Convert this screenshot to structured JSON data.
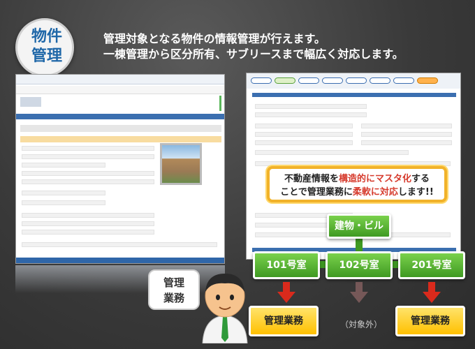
{
  "badge": {
    "line1": "物件",
    "line2": "管理"
  },
  "headline": {
    "line1": "管理対象となる物件の情報管理が行えます。",
    "line2": "一棟管理から区分所有、サブリースまで幅広く対応します。"
  },
  "callout": {
    "line1_pre": "不動産情報を",
    "line1_hl": "構造的にマスタ化",
    "line1_post": "する",
    "line2_pre": "ことで管理業務に",
    "line2_hl": "柔軟に対応",
    "line2_post": "します!!"
  },
  "diagram": {
    "building": "建物・ビル",
    "units": [
      "101号室",
      "102号室",
      "201号室"
    ],
    "managed_label": "管理業務",
    "excluded_label": "（対象外）"
  },
  "speech_bubble": {
    "line1": "管理",
    "line2": "業務"
  },
  "colors": {
    "accent_blue": "#1f67a8",
    "green": "#4aa52a",
    "orange": "#ffc000",
    "highlight_red": "#d63a2c",
    "arrow_red": "#d92a1c"
  }
}
